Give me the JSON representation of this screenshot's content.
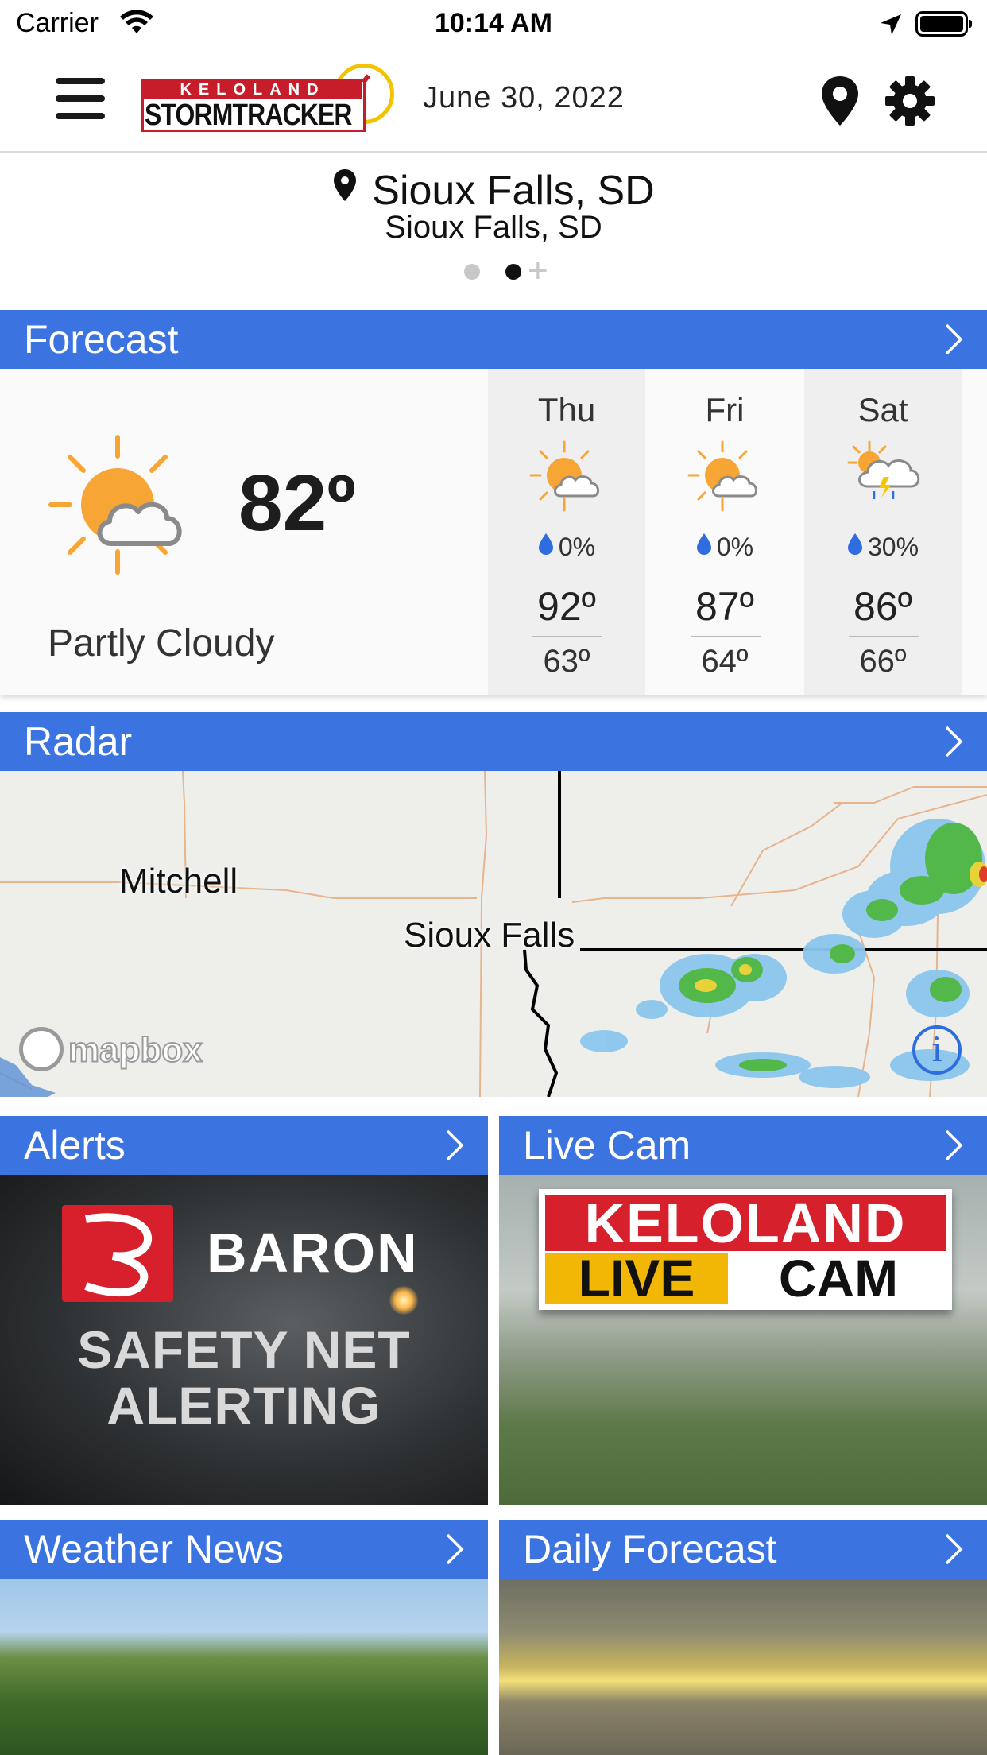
{
  "status_bar": {
    "carrier": "Carrier",
    "time": "10:14 AM"
  },
  "header": {
    "logo_top": "KELOLAND",
    "logo_bottom": "STORMTRACKER",
    "date": "June 30, 2022"
  },
  "location": {
    "title": "Sioux Falls, SD",
    "subtitle": "Sioux Falls, SD",
    "page_dots": 2,
    "active_dot": 2
  },
  "forecast": {
    "header": "Forecast",
    "current": {
      "temp": "82º",
      "condition": "Partly Cloudy",
      "icon": "partly-cloudy-icon"
    },
    "days": [
      {
        "name": "Thu",
        "precip": "0%",
        "high": "92º",
        "low": "63º",
        "icon": "partly-cloudy-icon"
      },
      {
        "name": "Fri",
        "precip": "0%",
        "high": "87º",
        "low": "64º",
        "icon": "partly-cloudy-icon"
      },
      {
        "name": "Sat",
        "precip": "30%",
        "high": "86º",
        "low": "66º",
        "icon": "thunderstorm-icon"
      }
    ]
  },
  "radar": {
    "header": "Radar",
    "labels": {
      "city1": "Mitchell",
      "city2": "Sioux Falls"
    },
    "watermark": "mapbox"
  },
  "tiles": {
    "alerts": {
      "header": "Alerts",
      "brand": "BARON",
      "line1": "SAFETY NET",
      "line2": "ALERTING"
    },
    "live_cam": {
      "header": "Live Cam",
      "top": "KELOLAND",
      "live": "LIVE",
      "cam": "CAM"
    },
    "weather_news": {
      "header": "Weather News"
    },
    "daily_forecast": {
      "header": "Daily Forecast"
    }
  },
  "colors": {
    "accent": "#3b74e0",
    "sun": "#f7a534",
    "drop": "#2e6ce0"
  }
}
